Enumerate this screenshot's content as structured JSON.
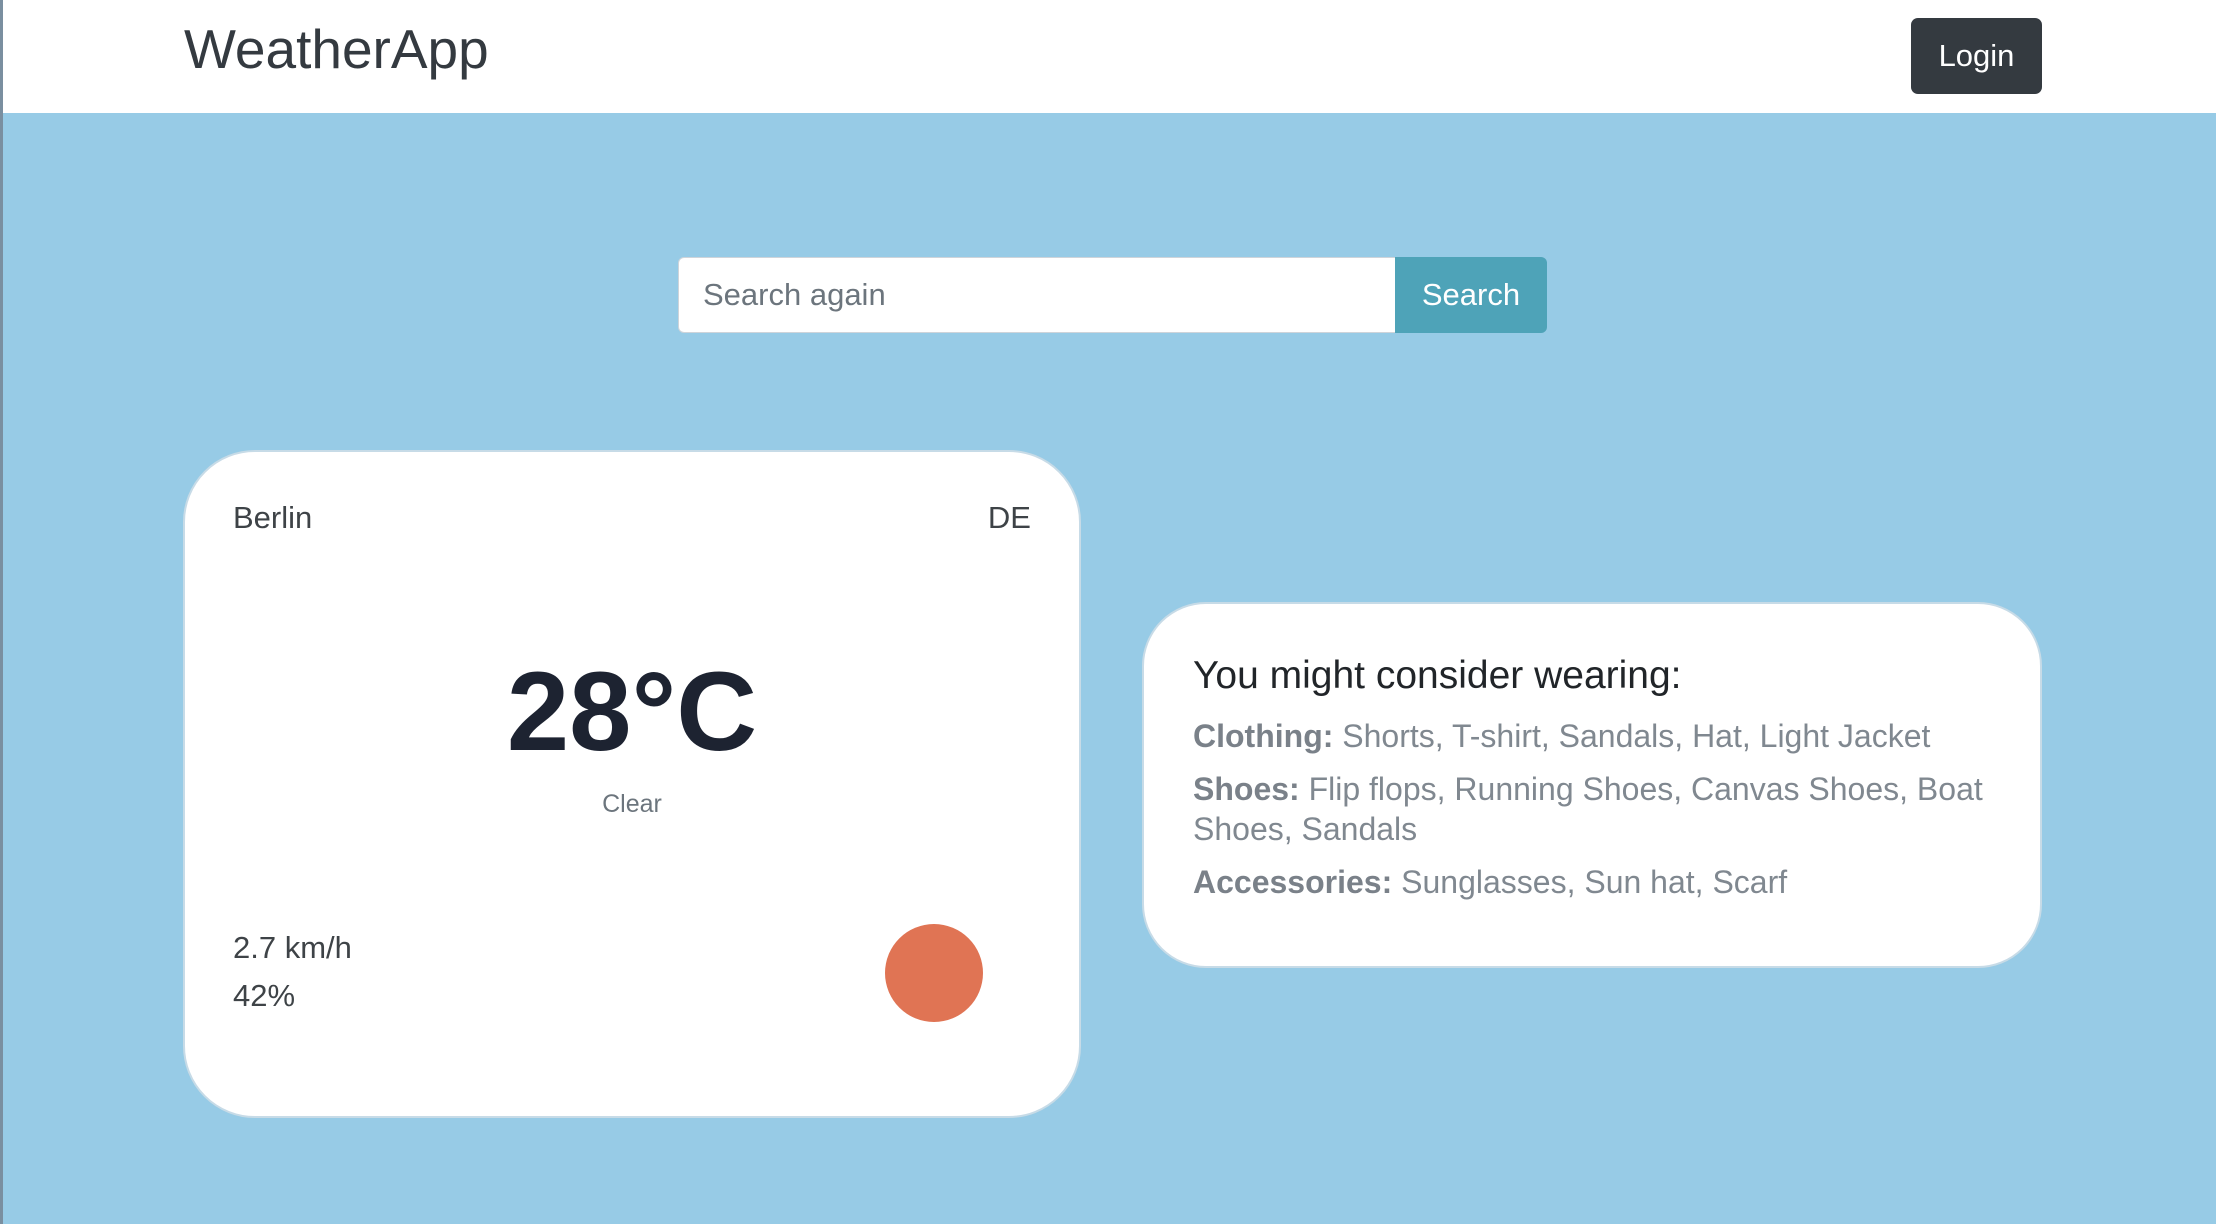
{
  "navbar": {
    "brand": "WeatherApp",
    "login_label": "Login"
  },
  "search": {
    "placeholder": "Search again",
    "value": "",
    "button_label": "Search"
  },
  "weather": {
    "city": "Berlin",
    "country": "DE",
    "temperature": "28°C",
    "condition": "Clear",
    "wind": "2.7 km/h",
    "humidity": "42%",
    "icon": "sun-icon",
    "icon_color": "#e07454"
  },
  "wear": {
    "title": "You might consider wearing:",
    "clothing_label": "Clothing:",
    "clothing": "Shorts, T-shirt, Sandals, Hat, Light Jacket",
    "shoes_label": "Shoes:",
    "shoes": "Flip flops, Running Shoes, Canvas Shoes, Boat Shoes, Sandals",
    "accessories_label": "Accessories:",
    "accessories": "Sunglasses, Sun hat, Scarf"
  },
  "colors": {
    "background": "#97cbe6",
    "navbar_bg": "#ffffff",
    "dark_button": "#343a40",
    "search_button": "#4ea3b8"
  }
}
